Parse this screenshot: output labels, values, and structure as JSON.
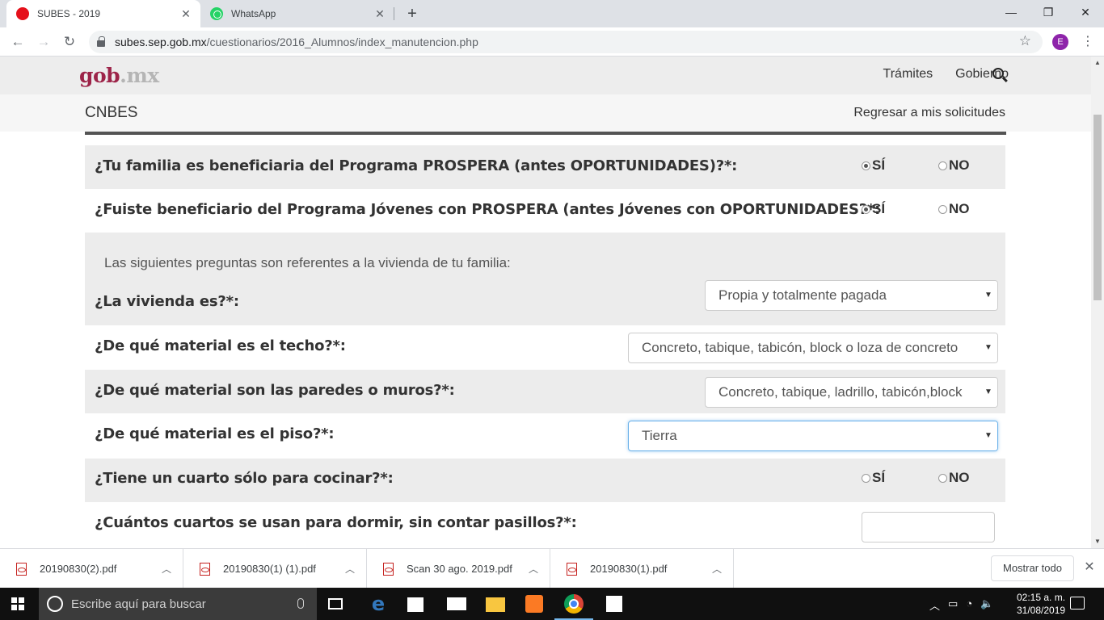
{
  "browser": {
    "tabs": [
      {
        "title": "SUBES - 2019",
        "active": true
      },
      {
        "title": "WhatsApp",
        "active": false
      }
    ],
    "new_tab": "+",
    "close_glyph": "✕",
    "window_controls": {
      "minimize": "—",
      "maximize": "❐",
      "close": "✕"
    },
    "url_host": "subes.sep.gob.mx",
    "url_path": "/cuestionarios/2016_Alumnos/index_manutencion.php",
    "profile_initial": "E"
  },
  "site": {
    "logo_main": "gob",
    "logo_suffix": ".mx",
    "nav": [
      "Trámites",
      "Gobierno"
    ],
    "section_title": "CNBES",
    "back_link": "Regresar a mis solicitudes"
  },
  "form": {
    "yes_label": "SÍ",
    "no_label": "NO",
    "q_prospera": "¿Tu familia es beneficiaria del Programa PROSPERA (antes OPORTUNIDADES)?*:",
    "q_jovenes": "¿Fuiste beneficiario del Programa Jóvenes con PROSPERA (antes Jóvenes con OPORTUNIDADES?*:",
    "intro": "Las siguientes preguntas son referentes a la vivienda de tu familia:",
    "q_vivienda": "¿La vivienda es?*:",
    "a_vivienda": "Propia y totalmente pagada",
    "q_techo": "¿De qué material es el techo?*:",
    "a_techo": "Concreto, tabique, tabicón, block o loza de concreto",
    "q_paredes": "¿De qué material son las paredes o muros?*:",
    "a_paredes": "Concreto, tabique, ladrillo, tabicón,block",
    "q_piso": "¿De qué material es el piso?*:",
    "a_piso": "Tierra",
    "q_cocina": "¿Tiene un cuarto sólo para cocinar?*:",
    "q_cuartos": "¿Cuántos cuartos se usan para dormir, sin contar pasillos?*:",
    "a_cuartos": "",
    "selected": {
      "prospera": "SÍ",
      "jovenes": "SÍ",
      "cocina": null
    }
  },
  "downloads": {
    "files": [
      "20190830(2).pdf",
      "20190830(1) (1).pdf",
      "Scan 30 ago. 2019.pdf",
      "20190830(1).pdf"
    ],
    "show_all": "Mostrar todo"
  },
  "taskbar": {
    "search_placeholder": "Escribe aquí para buscar",
    "time": "02:15 a. m.",
    "date": "31/08/2019"
  },
  "colors": {
    "brand": "#9d2449",
    "focus": "#66afe9",
    "row_grey": "#ececec"
  }
}
